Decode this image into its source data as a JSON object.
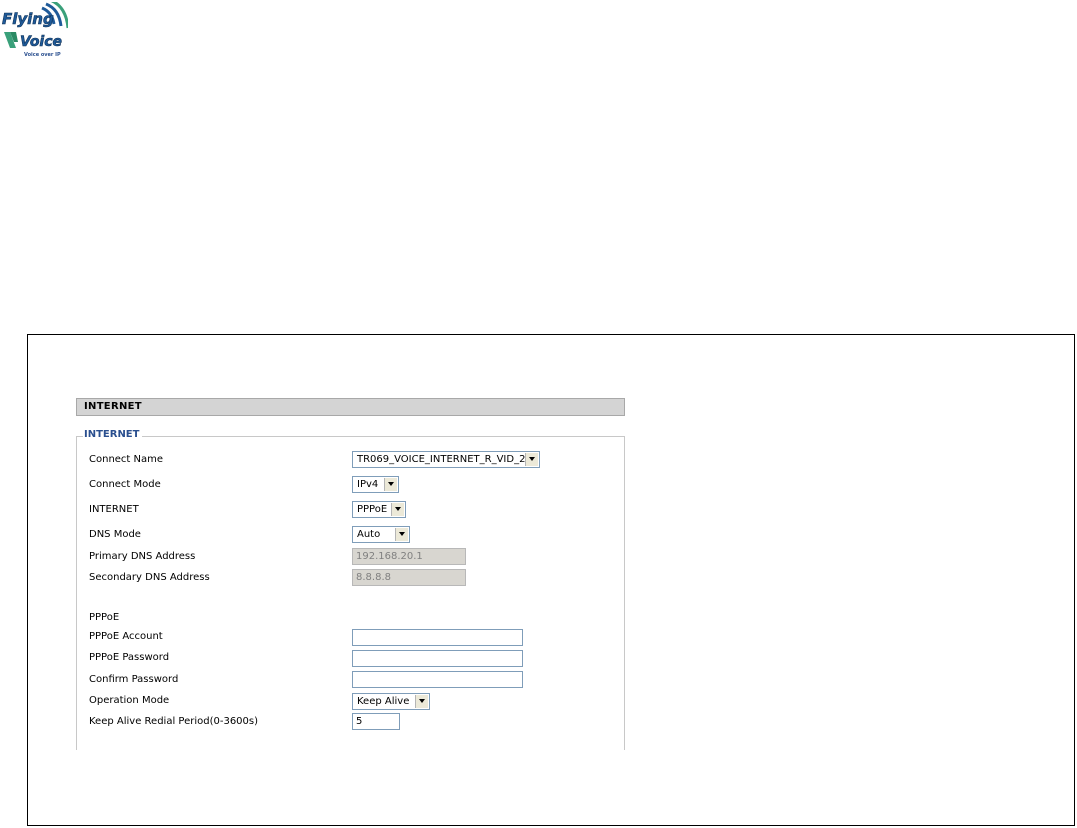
{
  "logo": {
    "line1": "Flying",
    "line2": "Voice",
    "tagline": "Voice over IP",
    "icon": "wifi-signal-icon"
  },
  "section": {
    "title": "INTERNET"
  },
  "fieldset": {
    "legend": "INTERNET"
  },
  "fields": {
    "connect_name": {
      "label": "Connect Name",
      "value": "TR069_VOICE_INTERNET_R_VID_2"
    },
    "connect_mode": {
      "label": "Connect Mode",
      "value": "IPv4"
    },
    "internet": {
      "label": "INTERNET",
      "value": "PPPoE"
    },
    "dns_mode": {
      "label": "DNS Mode",
      "value": "Auto"
    },
    "primary_dns": {
      "label": "Primary DNS Address",
      "value": "192.168.20.1"
    },
    "secondary_dns": {
      "label": "Secondary DNS Address",
      "value": "8.8.8.8"
    }
  },
  "pppoe": {
    "heading": "PPPoE",
    "account": {
      "label": "PPPoE Account",
      "value": ""
    },
    "password": {
      "label": "PPPoE Password",
      "value": ""
    },
    "confirm_password": {
      "label": "Confirm Password",
      "value": ""
    },
    "operation_mode": {
      "label": "Operation Mode",
      "value": "Keep Alive"
    },
    "redial_period": {
      "label": "Keep Alive Redial Period(0-3600s)",
      "value": "5"
    }
  },
  "colors": {
    "legend_blue": "#2a4f8f",
    "header_gray": "#d4d4d4",
    "logo_green": "#3aa07a",
    "logo_blue": "#1f5a99"
  }
}
